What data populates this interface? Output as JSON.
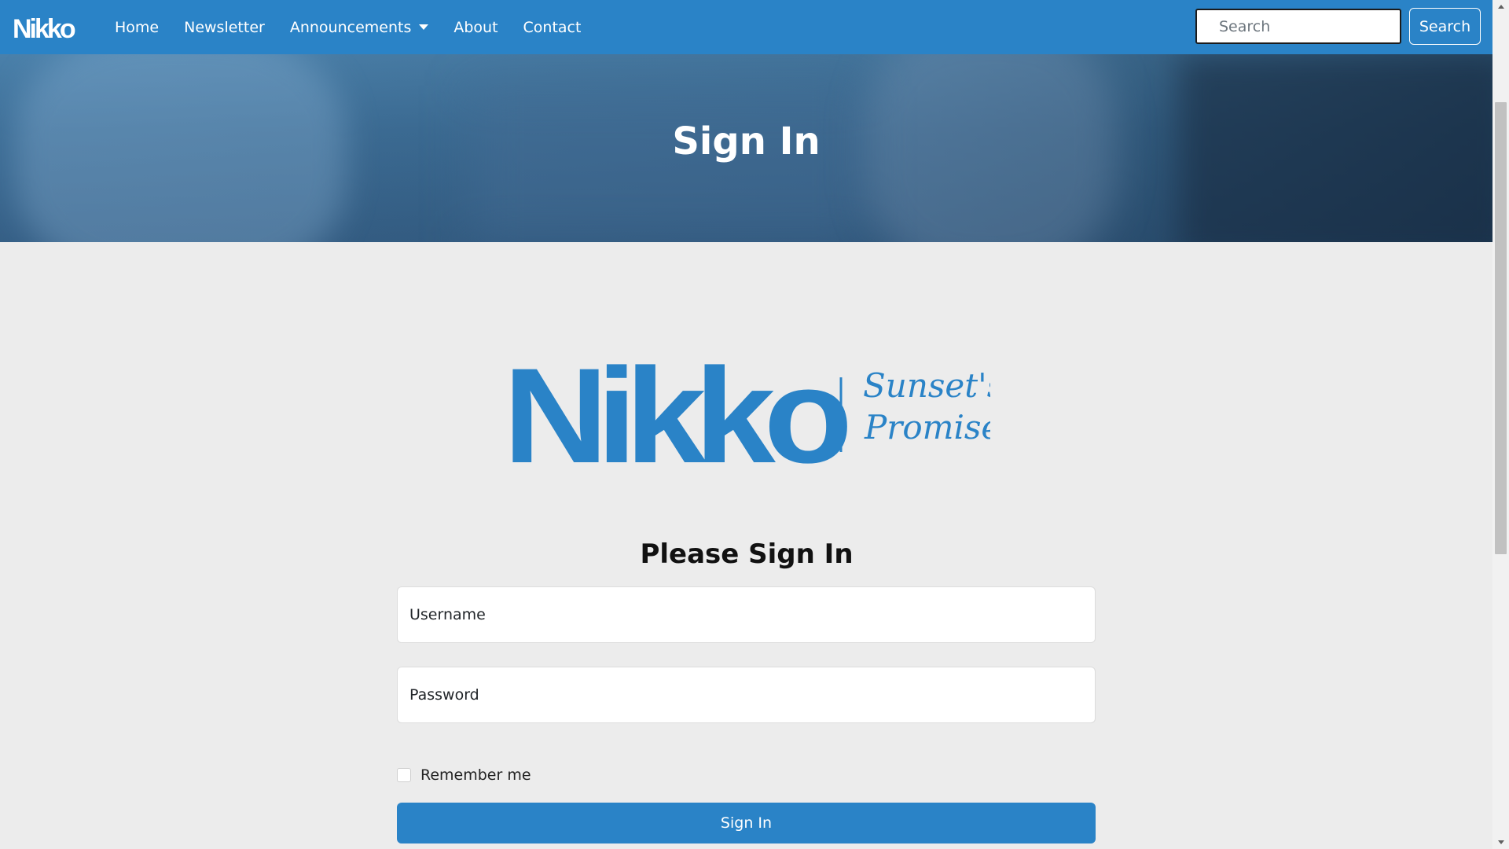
{
  "navbar": {
    "brand": "Nikko",
    "links": [
      {
        "label": "Home"
      },
      {
        "label": "Newsletter"
      },
      {
        "label": "Announcements"
      },
      {
        "label": "About"
      },
      {
        "label": "Contact"
      }
    ],
    "search": {
      "placeholder": "Search",
      "button_label": "Search"
    }
  },
  "hero": {
    "title": "Sign In"
  },
  "logo": {
    "main_text": "Nikko",
    "tagline_line1": "Sunset's",
    "tagline_line2": "Promise"
  },
  "form": {
    "title": "Please Sign In",
    "username_placeholder": "Username",
    "password_placeholder": "Password",
    "remember_label": "Remember me",
    "submit_label": "Sign In"
  },
  "colors": {
    "brand_blue": "#2a83c7",
    "page_bg": "#ececec"
  }
}
